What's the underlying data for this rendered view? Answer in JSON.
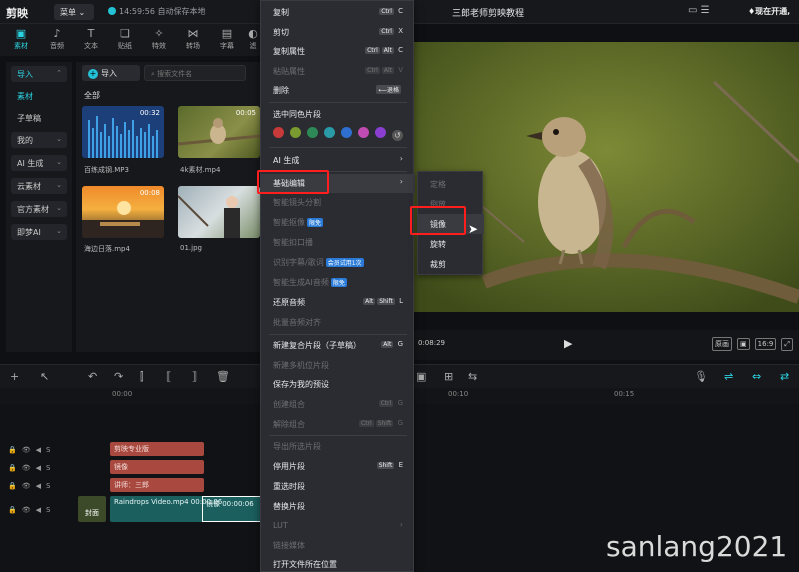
{
  "titlebar": {
    "logo": "剪映",
    "menu": "菜单 ⌄",
    "autosave": "14:59:56 自动保存本地",
    "doc_title": "三郎老师剪映教程",
    "icons": "▭ ☰",
    "vip": "♦现在开通,"
  },
  "tooltabs": [
    {
      "icon": "▣",
      "label": "素材"
    },
    {
      "icon": "♪",
      "label": "音频"
    },
    {
      "icon": "T",
      "label": "文本"
    },
    {
      "icon": "❏",
      "label": "贴纸"
    },
    {
      "icon": "✧",
      "label": "特效"
    },
    {
      "icon": "⋈",
      "label": "转场"
    },
    {
      "icon": "▤",
      "label": "字幕"
    },
    {
      "icon": "◐",
      "label": "滤"
    }
  ],
  "leftnav": [
    {
      "label": "导入",
      "style": "box"
    },
    {
      "label": "素材",
      "style": "plain"
    },
    {
      "label": "子草稿",
      "style": "plain"
    },
    {
      "label": "我的",
      "style": "box"
    },
    {
      "label": "AI 生成",
      "style": "box"
    },
    {
      "label": "云素材",
      "style": "box"
    },
    {
      "label": "官方素材",
      "style": "box"
    },
    {
      "label": "即梦AI",
      "style": "box"
    }
  ],
  "media": {
    "import_label": "导入",
    "search_placeholder": "搜索文件名",
    "all_label": "全部",
    "items": [
      {
        "name": "百练成钢.MP3",
        "duration": "00:32"
      },
      {
        "name": "4k素材.mp4",
        "duration": "00:05"
      },
      {
        "name": "海边日落.mp4",
        "duration": "00:08"
      },
      {
        "name": "01.jpg",
        "duration": ""
      }
    ]
  },
  "preview": {
    "time": "0:08:29",
    "ratio": "16:9",
    "btn1": "原画",
    "btn2": "▣"
  },
  "timeline": {
    "ruler": [
      "00:00",
      "00:10",
      "00:15"
    ],
    "text_clips": [
      "剪映专业版",
      "镜像",
      "讲师：三郎"
    ],
    "video_clip": "Raindrops Video.mp4  00:00:06",
    "video_clip2": "镜像 00:00:06",
    "cover_label": "封面"
  },
  "context_menu": {
    "items": [
      {
        "label": "复制",
        "shortcut_keys": [
          "Ctrl"
        ],
        "shortcut": "C",
        "disabled": false
      },
      {
        "label": "剪切",
        "shortcut_keys": [
          "Ctrl"
        ],
        "shortcut": "X",
        "disabled": false
      },
      {
        "label": "复制属性",
        "shortcut_keys": [
          "Ctrl",
          "Alt"
        ],
        "shortcut": "C",
        "disabled": false
      },
      {
        "label": "粘贴属性",
        "shortcut_keys": [
          "Ctrl",
          "Alt"
        ],
        "shortcut": "V",
        "disabled": true
      },
      {
        "label": "删除",
        "shortcut_keys": [
          "⟵退格"
        ],
        "shortcut": "",
        "disabled": false
      },
      {
        "label": "选中同色片段",
        "shortcut_keys": [],
        "shortcut": "",
        "disabled": false
      },
      {
        "label": "AI 生成",
        "shortcut_keys": [],
        "shortcut": "",
        "disabled": false,
        "arrow": true
      },
      {
        "label": "基础编辑",
        "shortcut_keys": [],
        "shortcut": "",
        "disabled": false,
        "arrow": true,
        "highlighted": true
      },
      {
        "label": "智能镜头分割",
        "disabled": true
      },
      {
        "label": "智能抠像",
        "badge": "限免",
        "disabled": true
      },
      {
        "label": "智能扣口播",
        "disabled": true
      },
      {
        "label": "识别字幕/歌词",
        "badge": "会员试用1次",
        "disabled": true
      },
      {
        "label": "智能生成AI音频",
        "badge": "限免",
        "disabled": true
      },
      {
        "label": "还原音频",
        "shortcut_keys": [
          "Alt",
          "Shift"
        ],
        "shortcut": "L",
        "disabled": false
      },
      {
        "label": "批量音频对齐",
        "disabled": true
      },
      {
        "label": "新建复合片段（子草稿）",
        "shortcut_keys": [
          "Alt"
        ],
        "shortcut": "G",
        "disabled": false
      },
      {
        "label": "新建多机位片段",
        "disabled": true
      },
      {
        "label": "保存为我的预设",
        "disabled": false
      },
      {
        "label": "创建组合",
        "shortcut_keys": [
          "Ctrl"
        ],
        "shortcut": "G",
        "disabled": true
      },
      {
        "label": "解除组合",
        "shortcut_keys": [
          "Ctrl",
          "Shift"
        ],
        "shortcut": "G",
        "disabled": true
      },
      {
        "label": "导出所选片段",
        "disabled": true
      },
      {
        "label": "停用片段",
        "shortcut_keys": [
          "Shift"
        ],
        "shortcut": "E",
        "disabled": false
      },
      {
        "label": "重选时段",
        "disabled": false
      },
      {
        "label": "替换片段",
        "disabled": false
      },
      {
        "label": "LUT",
        "disabled": true,
        "arrow": true
      },
      {
        "label": "链接媒体",
        "disabled": true
      },
      {
        "label": "打开文件所在位置",
        "disabled": false
      }
    ],
    "colors": [
      "#c83a3a",
      "#7a9b2f",
      "#2d8a56",
      "#2a9aa8",
      "#2e6fd0",
      "#c04bb2",
      "#8a3fd0"
    ]
  },
  "submenu": {
    "items": [
      {
        "label": "定格",
        "disabled": true
      },
      {
        "label": "倒放",
        "disabled": true
      },
      {
        "label": "镜像",
        "disabled": false,
        "highlighted": true
      },
      {
        "label": "旋转",
        "disabled": false
      },
      {
        "label": "裁剪",
        "disabled": false
      }
    ]
  },
  "watermark": "sanlang2021"
}
